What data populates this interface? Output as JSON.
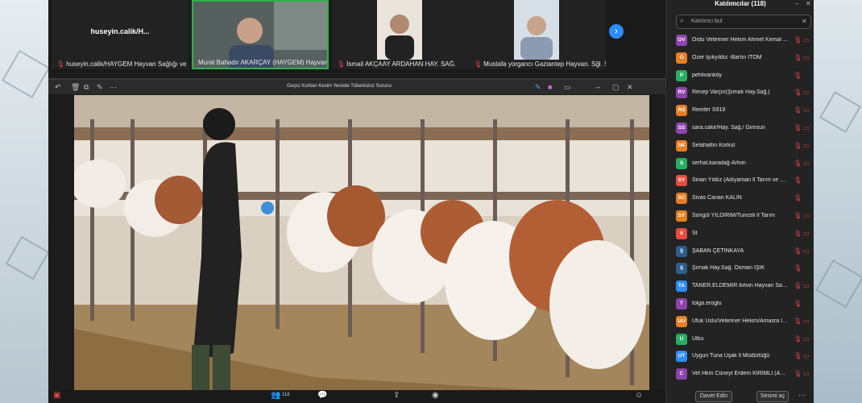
{
  "tiles": [
    {
      "name": "huseyin.calik/H...",
      "label": "huseyin.calik/HAYGEM Hayvan Sağlığı ve Epidemi..."
    },
    {
      "label": "Murat Bahadır AKARÇAY (HAYGEM) Hayvan Sağlığı v..."
    },
    {
      "label": "İsmail AKÇAAY ARDAHAN HAY. SAĞ."
    },
    {
      "label": "Mustafa yorgancı Gaziantep  Hayvan. Sğl. Şb.Md."
    }
  ],
  "share": {
    "title": "Geçici Kurban Kesim Yerinde Tüberküloz Sorunu"
  },
  "toolbar": {
    "participants_count": "118"
  },
  "panel": {
    "title": "Katılımcılar (118)",
    "search_placeholder": "Katılımcı bul",
    "invite_label": "Davet Edin",
    "mute_all_label": "Sesimi aç"
  },
  "participants": [
    {
      "initials": "OV",
      "color": "#8e44ad",
      "name": "Ordu Veteriner Hekim Ahmet Kemal ...",
      "video": true
    },
    {
      "initials": "Ö",
      "color": "#e67e22",
      "name": "Özer Işıkyıldız -Bartın İTOM",
      "video": true
    },
    {
      "initials": "P",
      "color": "#27ae60",
      "name": "pehlivanköy",
      "video": false
    },
    {
      "initials": "RV",
      "color": "#8e44ad",
      "name": "Recep Varçin(Şırnak Hay.Sağ.)",
      "video": true
    },
    {
      "initials": "RS",
      "color": "#e67e22",
      "name": "Reeder S919",
      "video": true
    },
    {
      "initials": "SS",
      "color": "#8e44ad",
      "name": "sara.cakir/Hay. Sağ./ Giresun",
      "video": true
    },
    {
      "initials": "SK",
      "color": "#e67e22",
      "name": "Selahattin Korkut",
      "video": true
    },
    {
      "initials": "S",
      "color": "#27ae60",
      "name": "serhat.karadağ-Artvin",
      "video": true
    },
    {
      "initials": "SY",
      "color": "#e74c3c",
      "name": "Sinan Yıldız (Adıyaman İl Tarım ve Orman...",
      "video": false
    },
    {
      "initials": "SC",
      "color": "#e67e22",
      "name": "Sivas Canan KALIN",
      "video": false
    },
    {
      "initials": "SY",
      "color": "#e67e22",
      "name": "Songül YILDIRIM/Tunceli İl Tarım",
      "video": true
    },
    {
      "initials": "S",
      "color": "#e74c3c",
      "name": "St",
      "video": true
    },
    {
      "initials": "Ş",
      "color": "#2d5b8a",
      "name": "ŞABAN ÇETİNKAYA",
      "video": true
    },
    {
      "initials": "Ş",
      "color": "#2d5b8a",
      "name": "Şırnak Hay.Sağ. Osman IŞIK",
      "video": false
    },
    {
      "initials": "TA",
      "color": "#2d8cff",
      "name": "TANER.ELDEMİR Artvin Hayvan Sağlı...",
      "video": true
    },
    {
      "initials": "T",
      "color": "#8e44ad",
      "name": "tolga.eroglu",
      "video": false
    },
    {
      "initials": "UU",
      "color": "#e67e22",
      "name": "Ufuk Uslu/Veteriner Hekim/Amasra İlçe T...",
      "video": true
    },
    {
      "initials": "U",
      "color": "#27ae60",
      "name": "Utku",
      "video": true
    },
    {
      "initials": "UT",
      "color": "#2d8cff",
      "name": "Uygun Tuna Uşak İl Müdürlüğü",
      "video": true
    },
    {
      "initials": "C",
      "color": "#8e44ad",
      "name": "Vet Hkm Cüneyt Erdem KIRIMLI (Ama...",
      "video": true
    }
  ]
}
